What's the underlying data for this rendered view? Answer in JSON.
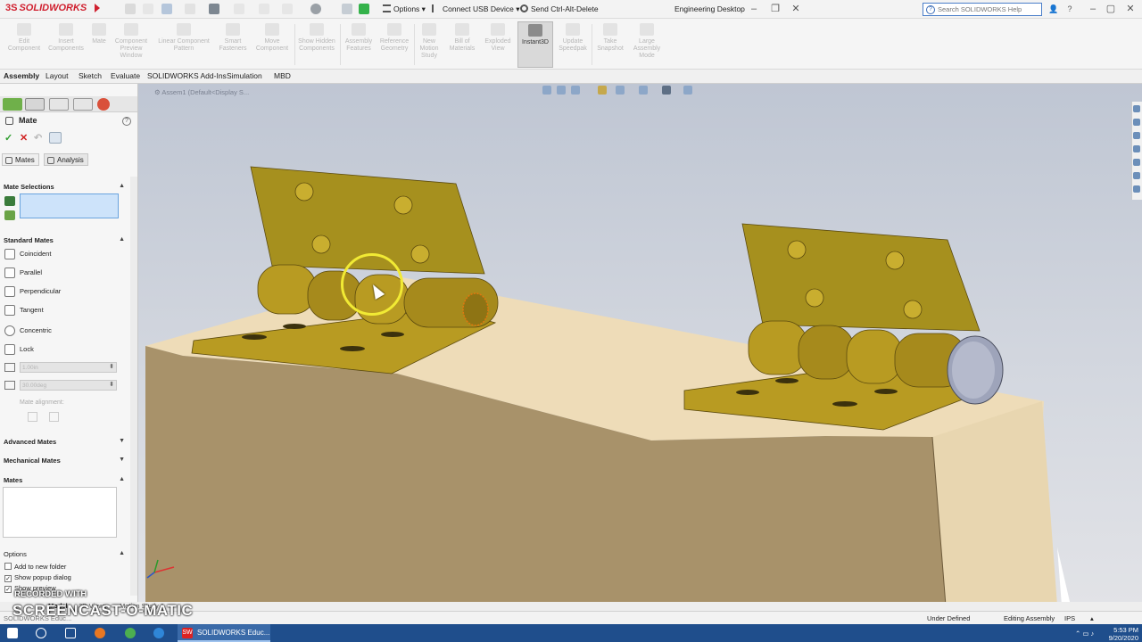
{
  "app": {
    "logo": "SOLIDWORKS",
    "window_title": "Engineering Desktop",
    "commands": [
      "Options",
      "Connect USB Device",
      "Send Ctrl-Alt-Delete"
    ],
    "help_search_placeholder": "Search SOLIDWORKS Help"
  },
  "ribbon": {
    "buttons": [
      "Edit Component",
      "Insert Components",
      "Mate",
      "Component Preview Window",
      "Linear Component Pattern",
      "Smart Fasteners",
      "Move Component",
      "Show Hidden Components",
      "Assembly Features",
      "Reference Geometry",
      "New Motion Study",
      "Bill of Materials",
      "Exploded View",
      "Instant3D",
      "Update Speedpak",
      "Take Snapshot",
      "Large Assembly Mode"
    ],
    "active_button": "Instant3D"
  },
  "tabs": [
    "Assembly",
    "Layout",
    "Sketch",
    "Evaluate",
    "SOLIDWORKS Add-Ins",
    "Simulation",
    "MBD"
  ],
  "active_tab": "Assembly",
  "property_manager": {
    "title": "Mate",
    "subtabs": [
      "Mates",
      "Analysis"
    ],
    "sections": {
      "mate_selections": "Mate Selections",
      "standard_mates": "Standard Mates",
      "advanced_mates": "Advanced Mates",
      "mechanical_mates": "Mechanical Mates",
      "mates": "Mates",
      "options": "Options"
    },
    "standard_mates": [
      "Coincident",
      "Parallel",
      "Perpendicular",
      "Tangent",
      "Concentric",
      "Lock"
    ],
    "distance_value": "1.00in",
    "angle_value": "30.00deg",
    "mate_alignment_label": "Mate alignment:",
    "options": [
      {
        "label": "Add to new folder",
        "checked": false
      },
      {
        "label": "Show popup dialog",
        "checked": true
      },
      {
        "label": "Show preview",
        "checked": true
      }
    ]
  },
  "viewport": {
    "tree_item": "Assem1 (Default<Display S..."
  },
  "bottom_tabs": [
    "Model",
    "3D Views",
    "Motion Study 1"
  ],
  "active_bottom_tab": "Model",
  "status": {
    "left": "SOLIDWORKS Educ...",
    "state": "Under Defined",
    "mode": "Editing Assembly",
    "units": "IPS"
  },
  "watermark": {
    "line1": "RECORDED WITH",
    "line2": "SCREENCAST-O-MATIC"
  },
  "taskbar": {
    "app_label": "SOLIDWORKS Educ...",
    "time": "5:53 PM",
    "date": "9/20/2020"
  },
  "colors": {
    "brand_red": "#d0202f",
    "hinge_gold": "#c4a52a",
    "block_beige": "#e9d7b2",
    "selection_blue": "#cde3fa",
    "taskbar_blue": "#1f4e8c"
  }
}
